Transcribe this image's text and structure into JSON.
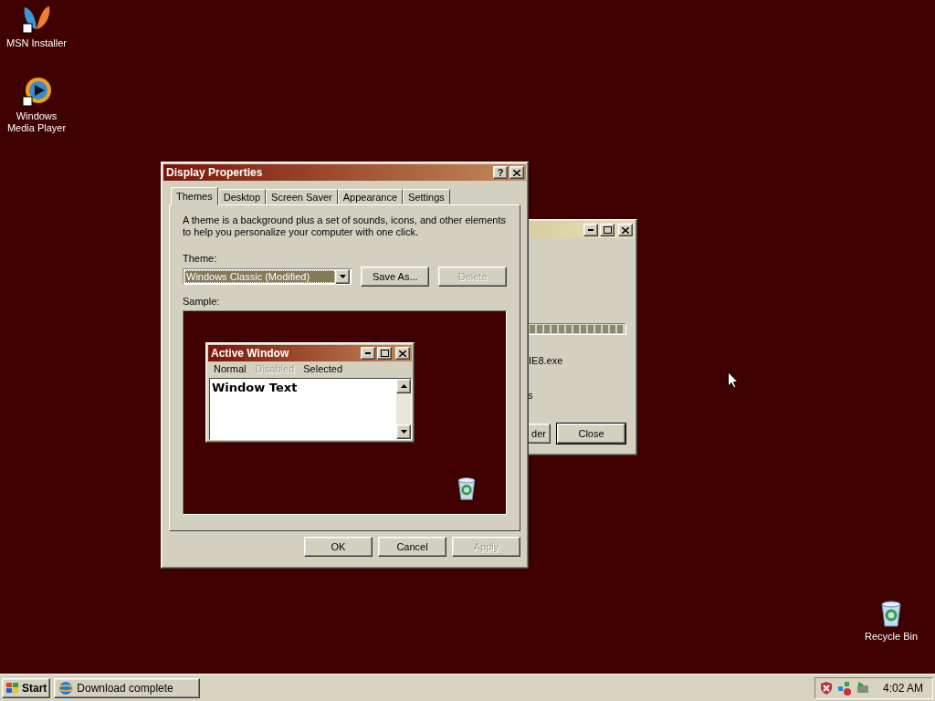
{
  "desktop_icons": [
    {
      "label": "MSN Installer",
      "kind": "butterfly"
    },
    {
      "label": "Windows Media Player",
      "kind": "player"
    },
    {
      "label": "Recycle Bin",
      "kind": "bin"
    }
  ],
  "background_window": {
    "progress": {
      "level": 1
    },
    "text_1": "IE8.exe",
    "text_2": "s",
    "buttons": [
      {
        "label": "der"
      },
      {
        "label": "Close"
      }
    ]
  },
  "dialog": {
    "title": "Display Properties",
    "help_button": "?",
    "tabs": [
      {
        "label": "Themes",
        "selected": true
      },
      {
        "label": "Desktop",
        "selected": false
      },
      {
        "label": "Screen Saver",
        "selected": false
      },
      {
        "label": "Appearance",
        "selected": false
      },
      {
        "label": "Settings",
        "selected": false
      }
    ],
    "description": "A theme is a background plus a set of sounds, icons, and other elements to help you personalize your computer with one click.",
    "theme_label": "Theme:",
    "theme_value": "Windows Classic (Modified)",
    "theme_buttons": [
      {
        "label": "Save As...",
        "disabled": false
      },
      {
        "label": "Delete",
        "disabled": true
      }
    ],
    "sample_label": "Sample:",
    "sample": {
      "title": "Active Window",
      "menu": [
        {
          "label": "Normal",
          "disabled": false
        },
        {
          "label": "Disabled",
          "disabled": true
        },
        {
          "label": "Selected",
          "disabled": false
        }
      ],
      "window_text": "Window Text"
    },
    "buttons": [
      {
        "label": "OK",
        "disabled": false
      },
      {
        "label": "Cancel",
        "disabled": false
      },
      {
        "label": "Apply",
        "disabled": true
      }
    ]
  },
  "taskbar": {
    "start": "Start",
    "tasks": [
      {
        "label": "Download complete"
      }
    ],
    "clock": "4:02 AM"
  }
}
